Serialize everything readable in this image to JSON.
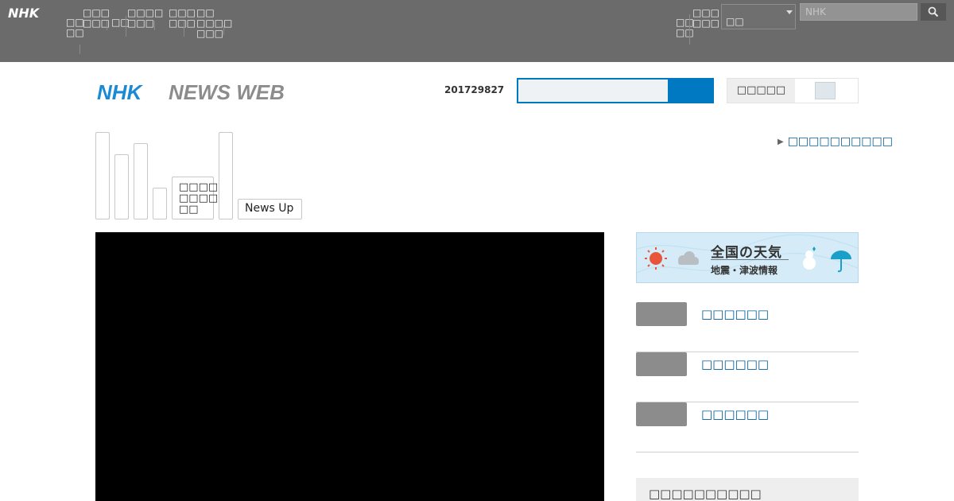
{
  "global_nav": {
    "logo_text": "NHK",
    "items": [
      {
        "label": "□□\n□□"
      },
      {
        "label": "□□□\n□□□"
      },
      {
        "label": "□□"
      },
      {
        "label": "□□□□\n□□□"
      },
      {
        "label": "□□□\n□□□"
      },
      {
        "label": "□□\n□□□□\n□□□"
      }
    ],
    "right_items": [
      {
        "label": "□□\n□□"
      },
      {
        "label": "□□□\n□□□"
      }
    ],
    "region_label": "□□",
    "search_placeholder": "NHK",
    "search_icon": "search-icon"
  },
  "header": {
    "logo_text_1": "NHK",
    "logo_text_2": "NEWS WEB",
    "date": "201729827",
    "search_value": "",
    "toggle_label": "□□□□□"
  },
  "categories": {
    "tabs": [
      {
        "label": ""
      },
      {
        "label": ""
      },
      {
        "label": ""
      },
      {
        "label": ""
      },
      {
        "label": "□□□□\n□□□□\n□□"
      },
      {
        "label": ""
      },
      {
        "label": "News Up"
      }
    ]
  },
  "login_link": "□□□□□□□□□□",
  "weather": {
    "title": "全国の天気",
    "subtitle": "地震・津波情報"
  },
  "sidebar": {
    "items": [
      {
        "label": "□□□□□□"
      },
      {
        "label": "□□□□□□"
      },
      {
        "label": "□□□□□□"
      }
    ],
    "box_title": "□□□□□□□□□□"
  },
  "colors": {
    "topbar": "#6b6b6b",
    "accent": "#0079c2",
    "link": "#005b96",
    "logo_blue": "#1a8ad4",
    "logo_gray": "#8c8c8c"
  }
}
